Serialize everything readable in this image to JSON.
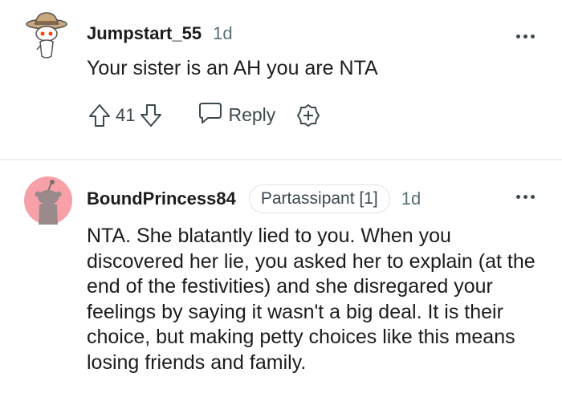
{
  "comments": [
    {
      "username": "Jumpstart_55",
      "time": "1d",
      "text": "Your sister is an AH you are NTA",
      "score": "41",
      "reply_label": "Reply",
      "avatar_icon": "cowboy-snoo-avatar-icon"
    },
    {
      "username": "BoundPrincess84",
      "flair": "Partassipant [1]",
      "time": "1d",
      "text": "NTA. She blatantly lied to you. When you discovered her lie, you asked her to explain (at the end of the festivities) and she disregared your feelings by saying it wasn't a big deal. It is their choice, but making petty choices like this means losing friends and family.",
      "avatar_icon": "pink-snoo-avatar-icon",
      "avatar_color": "#f7a0a8"
    }
  ],
  "colors": {
    "text": "#1c1c1c",
    "secondary": "#576f76",
    "icon": "#3c4a50",
    "divider": "#eceff1"
  }
}
